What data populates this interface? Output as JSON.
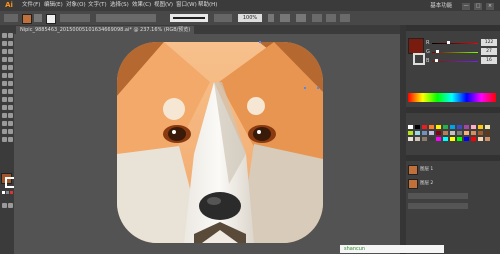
{
  "app": {
    "logo": "Ai"
  },
  "menus": [
    "文件(F)",
    "编辑(E)",
    "对象(O)",
    "文字(T)",
    "选择(S)",
    "效果(C)",
    "视图(V)",
    "窗口(W)",
    "帮助(H)"
  ],
  "workspace": {
    "label": "基本功能"
  },
  "window_controls": [
    "—",
    "□",
    "×"
  ],
  "control_bar": {
    "opacity_value": "100%"
  },
  "document": {
    "tab_title": "Nipic_9885463_20150005101634669098.ai* @ 237.16% (RGB/预览)"
  },
  "color_panel": {
    "accent": "#7a1b10",
    "channels": [
      {
        "letter": "R",
        "value": "122"
      },
      {
        "letter": "G",
        "value": "27"
      },
      {
        "letter": "B",
        "value": "16"
      }
    ]
  },
  "swatches": {
    "colors": [
      "#ffffff",
      "#000000",
      "#ed1c24",
      "#ff7f27",
      "#fff200",
      "#22b14c",
      "#00a2e8",
      "#3f48cc",
      "#a349a4",
      "#ffaec9",
      "#ffc90e",
      "#efe4b0",
      "#b5e61d",
      "#99d9ea",
      "#7092be",
      "#c8bfe7",
      "#880015",
      "#b97a57",
      "#c3c3c3",
      "#7f7f7f",
      "#f7b27a",
      "#d98d5a",
      "#a05a2c",
      "#603913",
      "#e8e1d6",
      "#d0c4b4",
      "#8c7b6b",
      "#3b3b3b",
      "#ff00ff",
      "#00ffff",
      "#ffff00",
      "#00ff00",
      "#0000ff",
      "#ff0000",
      "#f8d5b1",
      "#cf9165"
    ]
  },
  "layers_panel": {
    "rows": [
      "图层 1",
      "图层 2"
    ]
  },
  "footer": {
    "watermark": "shancun"
  }
}
